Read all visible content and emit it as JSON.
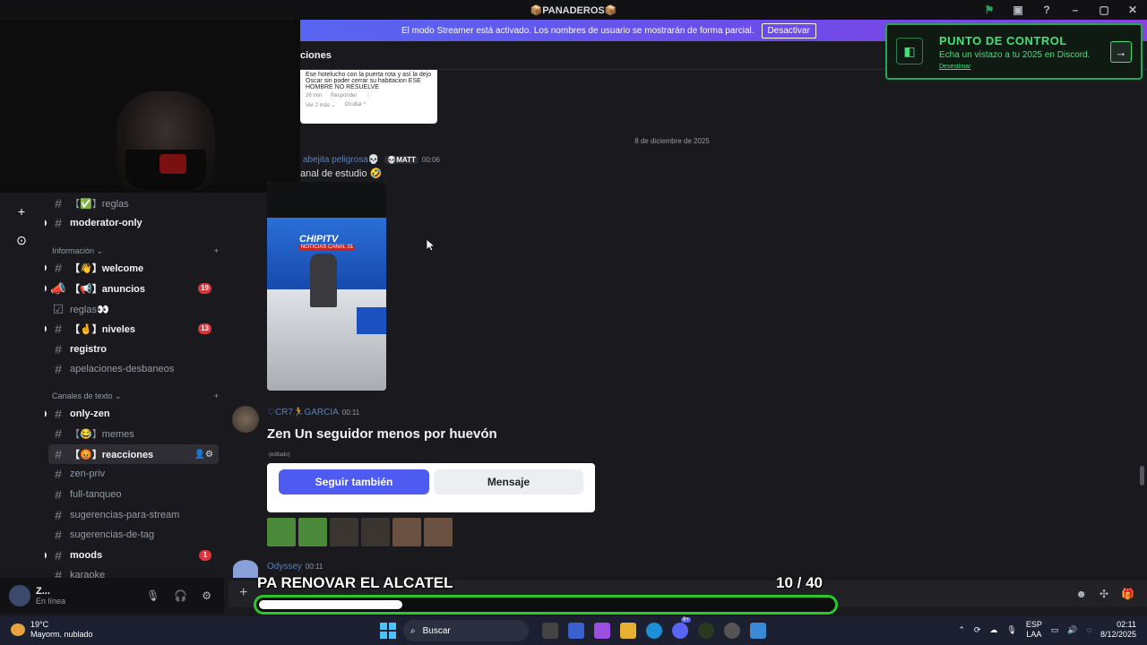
{
  "titlebar": {
    "title": "📦PANADEROS📦"
  },
  "banner": {
    "text": "El modo Streamer está activado. Los nombres de usuario se mostrarán de forma parcial.",
    "button": "Desactivar"
  },
  "chat_header": {
    "title": "ciones"
  },
  "reply_card": {
    "text": "Ese hotelucho con la puerta rota y así la dejo Oscar sin poder cerrar su habitacion ESE HOMBRE NO RESUELVE",
    "time": "26 min",
    "reply": "Responder",
    "more": "Ver 2 más ⌄",
    "hide": "Ocultar ^"
  },
  "date_divider": "8 de diciembre de 2025",
  "message1": {
    "user": "abejita peligrosa💀",
    "tag": "💀MATT",
    "time": "00:06",
    "text": "anal de estudio 🤣",
    "video": {
      "logo": "CHIPITV",
      "sub": "NOTICIAS CANAL 01"
    }
  },
  "message2": {
    "user": "♡CR7🏃GARCIA",
    "time": "00:11",
    "text": "Zen Un seguidor menos por huevón",
    "edited": "(editado)",
    "follow": "Seguir también",
    "message": "Mensaje"
  },
  "message3": {
    "user": "Odyssey",
    "time": "00:11"
  },
  "sidebar": {
    "channels_top": [
      {
        "name": "【✅】reglas",
        "bold": false
      },
      {
        "name": "moderator-only",
        "bold": true
      }
    ],
    "category_info": "Información ⌄",
    "info_channels": [
      {
        "name": "【👋】welcome",
        "bold": true
      },
      {
        "name": "【📢】anuncios",
        "bold": true,
        "badge": "19"
      },
      {
        "name": "reglas👀",
        "bold": false
      },
      {
        "name": "【🤞】niveles",
        "bold": true,
        "badge": "13"
      },
      {
        "name": "registro",
        "bold": true
      },
      {
        "name": "apelaciones-desbaneos",
        "bold": false
      }
    ],
    "category_text": "Canales de texto ⌄",
    "text_channels": [
      {
        "name": "only-zen",
        "bold": true
      },
      {
        "name": "【😂】memes",
        "bold": false
      },
      {
        "name": "【😡】reacciones",
        "bold": true,
        "active": true
      },
      {
        "name": "zen-priv",
        "bold": false
      },
      {
        "name": "full-tanqueo",
        "bold": false
      },
      {
        "name": "sugerencias-para-stream",
        "bold": false
      },
      {
        "name": "sugerencias-de-tag",
        "bold": false
      },
      {
        "name": "moods",
        "bold": true,
        "badge": "1"
      },
      {
        "name": "karaoke",
        "bold": false
      }
    ]
  },
  "user_panel": {
    "name": "Z...",
    "status": "En línea"
  },
  "checkpoint": {
    "title": "PUNTO DE CONTROL",
    "subtitle": "Echa un vistazo a tu 2025 en Discord.",
    "dismiss": "Desestimar"
  },
  "overlay": {
    "goal": "PA RENOVAR EL ALCATEL",
    "count": "10  / 40",
    "progress": 0.25
  },
  "taskbar": {
    "temp": "19°C",
    "weather": "Mayorm. nublado",
    "search": "Buscar",
    "lang_top": "ESP",
    "lang_bottom": "LAA",
    "time": "02:11",
    "date": "8/12/2025",
    "badge": "9+"
  }
}
